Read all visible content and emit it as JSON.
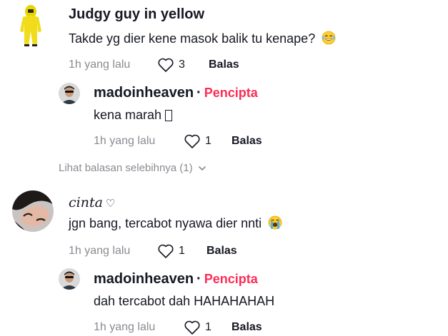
{
  "comments": [
    {
      "username": "Judgy guy in yellow",
      "text": "Takde yg dier kene masok balik tu kenape?",
      "emoji": "laughing-tears-emoji",
      "time": "1h yang lalu",
      "likes": "3",
      "reply_label": "Balas",
      "replies": [
        {
          "username": "madoinheaven",
          "separator": "·",
          "badge": "Pencipta",
          "text": "kena marah",
          "time": "1h yang lalu",
          "likes": "1",
          "reply_label": "Balas"
        }
      ],
      "more_replies": "Lihat balasan selebihnya (1)"
    },
    {
      "username": "cinta",
      "username_suffix": "♡",
      "text": "jgn bang, tercabot nyawa dier nnti",
      "emoji": "crying-loudly-emoji",
      "time": "1h yang lalu",
      "likes": "1",
      "reply_label": "Balas",
      "replies": [
        {
          "username": "madoinheaven",
          "separator": "·",
          "badge": "Pencipta",
          "text": "dah tercabot dah HAHAHAHAH",
          "time": "1h yang lalu",
          "likes": "1",
          "reply_label": "Balas"
        }
      ]
    }
  ],
  "colors": {
    "creator_badge": "#fe2c55",
    "muted": "#8a8b91",
    "text": "#161823"
  }
}
